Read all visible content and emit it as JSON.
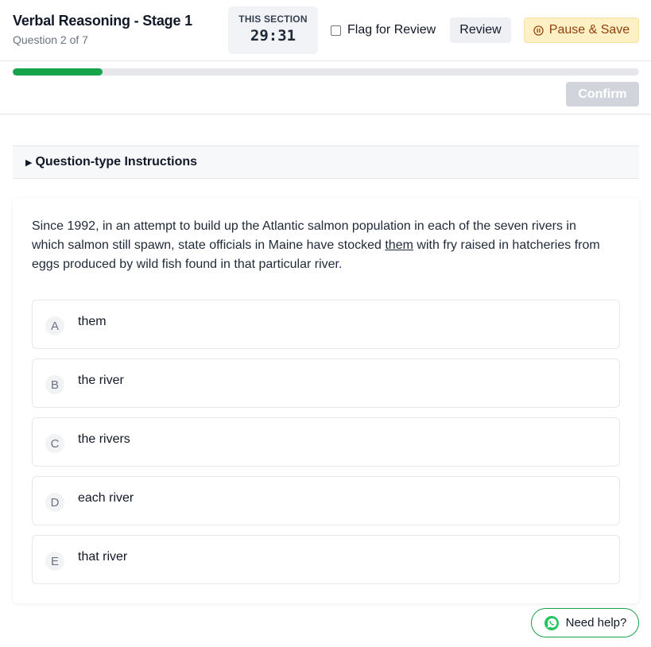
{
  "header": {
    "title": "Verbal Reasoning - Stage 1",
    "subtitle": "Question 2 of 7",
    "timer_label": "THIS SECTION",
    "timer_value": "29:31",
    "flag_label": "Flag for Review",
    "flag_checked": false,
    "review_label": "Review",
    "pause_label": "Pause & Save",
    "confirm_label": "Confirm",
    "progress_fraction": 0.143
  },
  "instructions": {
    "label": "Question-type Instructions",
    "expanded": false
  },
  "question": {
    "stem_before": "Since 1992, in an attempt to build up the Atlantic salmon population in each of the seven rivers in which salmon still spawn, state officials in Maine have stocked ",
    "stem_underlined": "them",
    "stem_after": " with fry raised in hatcheries from eggs produced by wild fish found in that particular river.",
    "options": [
      {
        "letter": "A",
        "text": "them"
      },
      {
        "letter": "B",
        "text": "the river"
      },
      {
        "letter": "C",
        "text": "the rivers"
      },
      {
        "letter": "D",
        "text": "each river"
      },
      {
        "letter": "E",
        "text": "that river"
      }
    ]
  },
  "help": {
    "label": "Need help?",
    "icon": "whatsapp-icon"
  },
  "colors": {
    "progress": "#16a34a",
    "pause_bg": "#fdf0c4",
    "pause_text": "#92400e",
    "confirm_disabled": "#d1d5db"
  }
}
